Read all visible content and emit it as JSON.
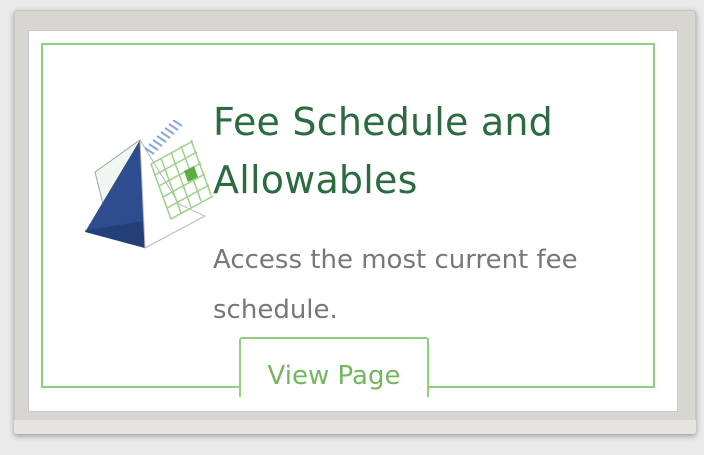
{
  "card": {
    "title": "Fee Schedule and Allowables",
    "description": "Access the most current fee schedule.",
    "button_label": "View Page",
    "icon": "calendar-icon"
  },
  "colors": {
    "title": "#2c6a3f",
    "accent_border": "#8fcf7e",
    "button_text": "#74b561",
    "description": "#777777"
  }
}
